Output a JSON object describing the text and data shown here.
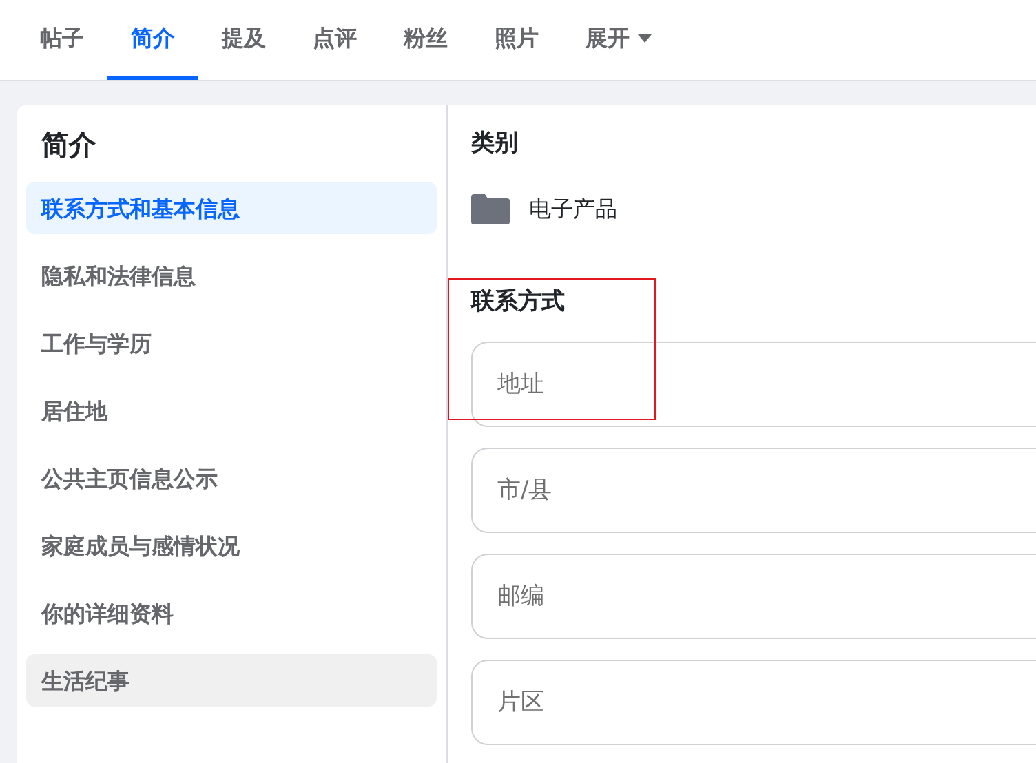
{
  "tabs": [
    {
      "label": "帖子",
      "selected": false
    },
    {
      "label": "简介",
      "selected": true
    },
    {
      "label": "提及",
      "selected": false
    },
    {
      "label": "点评",
      "selected": false
    },
    {
      "label": "粉丝",
      "selected": false
    },
    {
      "label": "照片",
      "selected": false
    },
    {
      "label": "展开",
      "selected": false,
      "kind": "dropdown"
    }
  ],
  "sidebar": {
    "title": "简介",
    "items": [
      {
        "label": "联系方式和基本信息",
        "selected": true,
        "highlighted": false
      },
      {
        "label": "隐私和法律信息",
        "selected": false,
        "highlighted": false
      },
      {
        "label": "工作与学历",
        "selected": false,
        "highlighted": false
      },
      {
        "label": "居住地",
        "selected": false,
        "highlighted": false
      },
      {
        "label": "公共主页信息公示",
        "selected": false,
        "highlighted": false
      },
      {
        "label": "家庭成员与感情状况",
        "selected": false,
        "highlighted": false
      },
      {
        "label": "你的详细资料",
        "selected": false,
        "highlighted": false
      },
      {
        "label": "生活纪事",
        "selected": false,
        "highlighted": true
      }
    ]
  },
  "category": {
    "heading": "类别",
    "value": "电子产品"
  },
  "contact": {
    "heading": "联系方式",
    "fields": [
      {
        "placeholder": "地址"
      },
      {
        "placeholder": "市/县"
      },
      {
        "placeholder": "邮编"
      },
      {
        "placeholder": "片区"
      }
    ]
  }
}
